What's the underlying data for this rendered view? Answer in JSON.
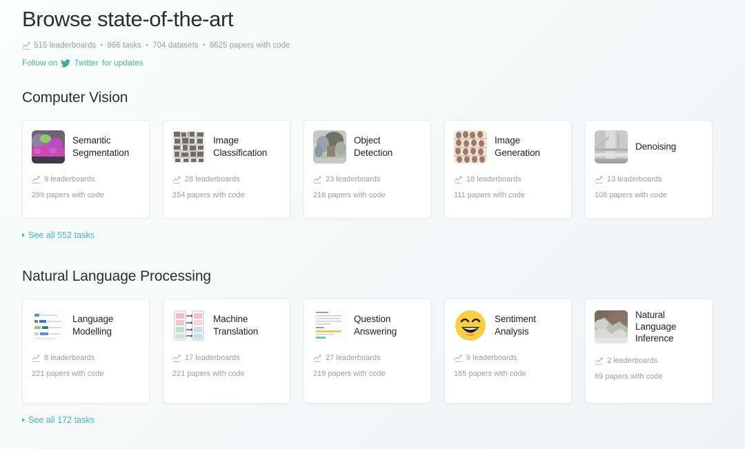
{
  "header": {
    "title": "Browse state-of-the-art",
    "stats_icon": "chart-icon",
    "stats": [
      "515 leaderboards",
      "966 tasks",
      "704 datasets",
      "8625 papers with code"
    ],
    "separator": "•",
    "follow_prefix": "Follow on",
    "follow_icon": "twitter-bird-icon",
    "follow_link": "Twitter",
    "follow_suffix": "for updates"
  },
  "accent_color": "#45b6ac",
  "text_muted_color": "#9a9fa3",
  "sections": [
    {
      "id": "cv",
      "title": "Computer Vision",
      "see_all": "See all 552 tasks",
      "cards": [
        {
          "title": "Semantic Segmentation",
          "thumb": "semantic-segmentation-thumb",
          "leaderboards": "9 leaderboards",
          "papers": "299 papers with code"
        },
        {
          "title": "Image Classification",
          "thumb": "image-classification-thumb",
          "leaderboards": "28 leaderboards",
          "papers": "254 papers with code"
        },
        {
          "title": "Object Detection",
          "thumb": "object-detection-thumb",
          "leaderboards": "23 leaderboards",
          "papers": "216 papers with code"
        },
        {
          "title": "Image Generation",
          "thumb": "image-generation-thumb",
          "leaderboards": "18 leaderboards",
          "papers": "111 papers with code"
        },
        {
          "title": "Denoising",
          "thumb": "denoising-thumb",
          "leaderboards": "13 leaderboards",
          "papers": "108 papers with code"
        }
      ]
    },
    {
      "id": "nlp",
      "title": "Natural Language Processing",
      "see_all": "See all 172 tasks",
      "cards": [
        {
          "title": "Language Modelling",
          "thumb": "language-modelling-thumb",
          "leaderboards": "8 leaderboards",
          "papers": "221 papers with code"
        },
        {
          "title": "Machine Translation",
          "thumb": "machine-translation-thumb",
          "leaderboards": "17 leaderboards",
          "papers": "221 papers with code"
        },
        {
          "title": "Question Answering",
          "thumb": "question-answering-thumb",
          "leaderboards": "27 leaderboards",
          "papers": "219 papers with code"
        },
        {
          "title": "Sentiment Analysis",
          "thumb": "sentiment-analysis-thumb",
          "leaderboards": "9 leaderboards",
          "papers": "165 papers with code"
        },
        {
          "title": "Natural Language Inference",
          "thumb": "natural-language-inference-thumb",
          "leaderboards": "2 leaderboards",
          "papers": "89 papers with code"
        }
      ]
    }
  ]
}
